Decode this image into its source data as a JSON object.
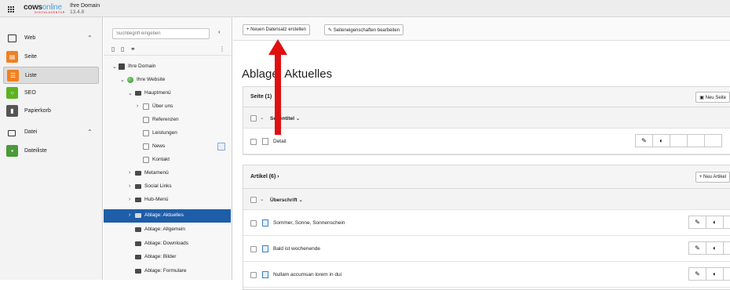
{
  "topbar": {
    "logo_main": "cows",
    "logo_accent": "online",
    "logo_sub": "DIGITALAGENTUR",
    "site_name": "Ihre Domain",
    "version": "13.4.8"
  },
  "modules": {
    "web": {
      "label": "Web",
      "icon": "page-icon"
    },
    "seite": {
      "label": "Seite",
      "icon": "page-module-icon",
      "color": "#f08020"
    },
    "liste": {
      "label": "Liste",
      "icon": "list-module-icon",
      "color": "#f08020"
    },
    "seo": {
      "label": "SEO",
      "icon": "search-module-icon",
      "color": "#5bb21f"
    },
    "papierkorb": {
      "label": "Papierkorb",
      "icon": "trash-icon",
      "color": "#555555"
    },
    "datei": {
      "label": "Datei",
      "icon": "image-icon"
    },
    "dateiliste": {
      "label": "Dateiliste",
      "icon": "filelist-module-icon",
      "color": "#4a9a3a"
    }
  },
  "tree": {
    "search_placeholder": "Suchbegriff eingeben",
    "nodes": [
      {
        "label": "Ihre Domain",
        "type": "root"
      },
      {
        "label": "Ihre Website",
        "type": "site"
      },
      {
        "label": "Hauptmenü",
        "type": "folder"
      },
      {
        "label": "Über uns",
        "type": "page"
      },
      {
        "label": "Referenzen",
        "type": "page"
      },
      {
        "label": "Leistungen",
        "type": "page"
      },
      {
        "label": "News",
        "type": "page"
      },
      {
        "label": "Kontakt",
        "type": "page"
      },
      {
        "label": "Metamenü",
        "type": "folder"
      },
      {
        "label": "Social Links",
        "type": "folder"
      },
      {
        "label": "Hub-Menü",
        "type": "folder"
      },
      {
        "label": "Ablage: Aktuelles",
        "type": "folder",
        "selected": true
      },
      {
        "label": "Ablage: Allgemein",
        "type": "folder"
      },
      {
        "label": "Ablage: Downloads",
        "type": "folder"
      },
      {
        "label": "Ablage: Bilder",
        "type": "folder"
      },
      {
        "label": "Ablage: Formulare",
        "type": "folder"
      }
    ]
  },
  "main": {
    "new_record_button": "Neuen Datensatz erstellen",
    "edit_page_button": "Seiteneigenschaften bearbeiten",
    "title": "Ablage: Aktuelles",
    "panel_seite": {
      "title": "Seite (1)",
      "new_button": "Neu Seite",
      "column_label": "Seitentitel",
      "rows": [
        {
          "label": "Detail"
        }
      ]
    },
    "panel_artikel": {
      "title": "Artikel (6)",
      "new_button": "Neu Artikel",
      "column_label": "Überschrift",
      "rows": [
        {
          "label": "Sommer, Sonne, Sonnenschein"
        },
        {
          "label": "Bald ist wochenende"
        },
        {
          "label": "Nullam accumsan lorem in dui"
        }
      ]
    }
  },
  "annotation_color": "#e01010"
}
